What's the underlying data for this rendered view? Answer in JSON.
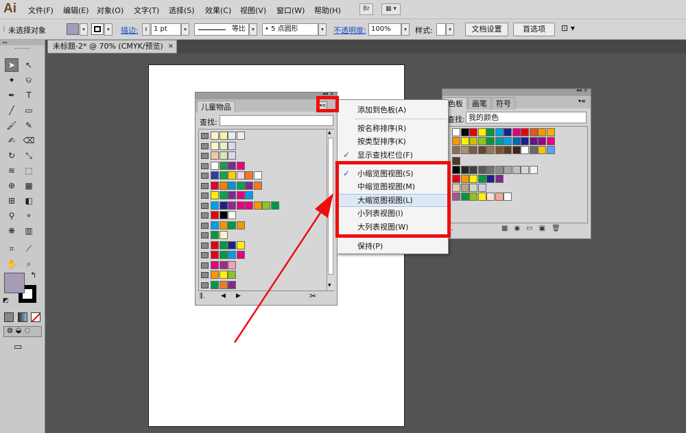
{
  "app": {
    "logo": "Ai",
    "br_label": "Br"
  },
  "menubar": {
    "items": [
      "文件(F)",
      "编辑(E)",
      "对象(O)",
      "文字(T)",
      "选择(S)",
      "效果(C)",
      "视图(V)",
      "窗口(W)",
      "帮助(H)"
    ]
  },
  "controlbar": {
    "selection_label": "未选择对象",
    "stroke_label": "描边:",
    "stroke_value": "1 pt",
    "dash_label": "等比",
    "brush_label": "5 点圆形",
    "opacity_label": "不透明度:",
    "opacity_value": "100%",
    "style_label": "样式:",
    "doc_setup_button": "文档设置",
    "prefs_button": "首选项"
  },
  "document": {
    "tab_title": "未标题-2* @ 70% (CMYK/预览)",
    "close_glyph": "×"
  },
  "tools": [
    {
      "name": "selection-tool-icon",
      "glyph": "➤"
    },
    {
      "name": "direct-selection-tool-icon",
      "glyph": "↖"
    },
    {
      "name": "magic-wand-tool-icon",
      "glyph": "✦"
    },
    {
      "name": "lasso-tool-icon",
      "glyph": "ଡ"
    },
    {
      "name": "pen-tool-icon",
      "glyph": "✒"
    },
    {
      "name": "type-tool-icon",
      "glyph": "T"
    },
    {
      "name": "line-tool-icon",
      "glyph": "╱"
    },
    {
      "name": "rectangle-tool-icon",
      "glyph": "▭"
    },
    {
      "name": "paintbrush-tool-icon",
      "glyph": "🖌"
    },
    {
      "name": "pencil-tool-icon",
      "glyph": "✎"
    },
    {
      "name": "blob-brush-tool-icon",
      "glyph": "✍"
    },
    {
      "name": "eraser-tool-icon",
      "glyph": "⌫"
    },
    {
      "name": "rotate-tool-icon",
      "glyph": "↻"
    },
    {
      "name": "scale-tool-icon",
      "glyph": "⤡"
    },
    {
      "name": "warp-tool-icon",
      "glyph": "≋"
    },
    {
      "name": "free-transform-tool-icon",
      "glyph": "⬚"
    },
    {
      "name": "shape-builder-tool-icon",
      "glyph": "⊕"
    },
    {
      "name": "live-paint-tool-icon",
      "glyph": "▦"
    },
    {
      "name": "perspective-grid-tool-icon",
      "glyph": "⊞"
    },
    {
      "name": "gradient-tool-icon",
      "glyph": "◧"
    },
    {
      "name": "eyedropper-tool-icon",
      "glyph": "⚲"
    },
    {
      "name": "blend-tool-icon",
      "glyph": "⚬"
    },
    {
      "name": "symbol-sprayer-tool-icon",
      "glyph": "❋"
    },
    {
      "name": "column-graph-tool-icon",
      "glyph": "▥"
    },
    {
      "name": "artboard-tool-icon",
      "glyph": "⌗"
    },
    {
      "name": "slice-tool-icon",
      "glyph": "⟋"
    },
    {
      "name": "hand-tool-icon",
      "glyph": "✋"
    },
    {
      "name": "zoom-tool-icon",
      "glyph": "⌕"
    }
  ],
  "colors": {
    "fill": "#a69cb8",
    "stroke": "#000000",
    "highlight_border": "#ee0e0e",
    "menu_hover": "#dde8f7"
  },
  "kids_panel": {
    "title": "儿童物品",
    "search_label": "查找:",
    "swatch_rows": [
      [
        "#fbf6c9",
        "#f7f3a8",
        "#e2ecf6",
        "#f4e8f4"
      ],
      [
        "#fbf6c9",
        "#e6f0c0",
        "#d9d9f2"
      ],
      [
        "#f2c9a3",
        "#d8e8b6",
        "#d8d8ee"
      ],
      [
        "#ffffff",
        "#1a9c49",
        "#7d2a8c",
        "#e9007d"
      ],
      [
        "#2f3ea0",
        "#16a34a",
        "#ffd400",
        "#f3d5dd",
        "#f47b20",
        "#ffffff"
      ],
      [
        "#e4002b",
        "#f08300",
        "#0097d6",
        "#00a650",
        "#7e2a8c",
        "#f47b20"
      ],
      [
        "#fff100",
        "#00a650",
        "#7e2a8c",
        "#e4007f",
        "#00a0e9"
      ],
      [
        "#00a0e9",
        "#1d2088",
        "#8e2c8c",
        "#e4007f",
        "#e4007f",
        "#f39800",
        "#8fc31f",
        "#009944"
      ],
      [
        "#e60012",
        "#000000",
        "#ffffff"
      ],
      [
        "#00a0e9",
        "#f39800",
        "#009944",
        "#f39800"
      ],
      [
        "#009944",
        "#fff5c3"
      ],
      [
        "#e60012",
        "#009944",
        "#1d2088",
        "#fff100"
      ],
      [
        "#e60012",
        "#009944",
        "#00a0e9",
        "#e4007f"
      ],
      [
        "#e4007f",
        "#a0288b",
        "#f19ec2"
      ],
      [
        "#f39800",
        "#fff100",
        "#8fc31f"
      ],
      [
        "#009944",
        "#e97d29",
        "#7e2a8c"
      ]
    ]
  },
  "flyout_menu": {
    "items": [
      {
        "label": "添加到色板(A)",
        "checked": false,
        "highlighted": false
      },
      {
        "label": "按名称排序(R)",
        "checked": false,
        "highlighted": false
      },
      {
        "label": "按类型排序(K)",
        "checked": false,
        "highlighted": false
      },
      {
        "label": "显示查找栏位(F)",
        "checked": true,
        "highlighted": false
      },
      {
        "label": "小缩览图视图(S)",
        "checked": true,
        "highlighted": false
      },
      {
        "label": "中缩览图视图(M)",
        "checked": false,
        "highlighted": false
      },
      {
        "label": "大缩览图视图(L)",
        "checked": false,
        "highlighted": true
      },
      {
        "label": "小列表视图(I)",
        "checked": false,
        "highlighted": false
      },
      {
        "label": "大列表视图(W)",
        "checked": false,
        "highlighted": false
      },
      {
        "label": "保持(P)",
        "checked": false,
        "highlighted": false
      }
    ],
    "check_glyph": "✓"
  },
  "swatches_panel": {
    "tabs": [
      "色板",
      "画笔",
      "符号"
    ],
    "search_label": "查找:",
    "search_value": "我的颜色",
    "rows": [
      [
        "#ffffff",
        "#000000",
        "#e60012",
        "#fff100",
        "#009944",
        "#00a0e9",
        "#1d2088",
        "#e4007f",
        "#e60012",
        "#e95513",
        "#f39800",
        "#f6ae00"
      ],
      [
        "#f39800",
        "#fff100",
        "#c9c100",
        "#8fc31f",
        "#009944",
        "#009e96",
        "#00a0e9",
        "#0068b7",
        "#1d2088",
        "#601986",
        "#920783",
        "#e4007f"
      ],
      [
        "#8c6d4f",
        "#a8916b",
        "#7a5d3e",
        "#5e4a32",
        "#9c7650",
        "#7c5230",
        "#5b3c22",
        "#3b2715",
        "#ffffff",
        "#6b6b6b",
        "#f8c300",
        "#5aa0ff"
      ],
      [
        "#4a3a2a"
      ],
      [
        "#000000",
        "#262626",
        "#404040",
        "#595959",
        "#737373",
        "#8c8c8c",
        "#a6a6a6",
        "#bfbfbf",
        "#d9d9d9",
        "#f2f2f2"
      ],
      [
        "#e60012",
        "#f39800",
        "#fff100",
        "#009944",
        "#1d2088",
        "#7e2a8c"
      ],
      [
        "#ded0b6",
        "#b5a48a",
        "#c7e0c4",
        "#d6cbe6"
      ],
      [
        "#a0588c",
        "#009944",
        "#8fc31f",
        "#fff100",
        "#fce0d3",
        "#f5a898",
        "#ffffff"
      ]
    ]
  }
}
